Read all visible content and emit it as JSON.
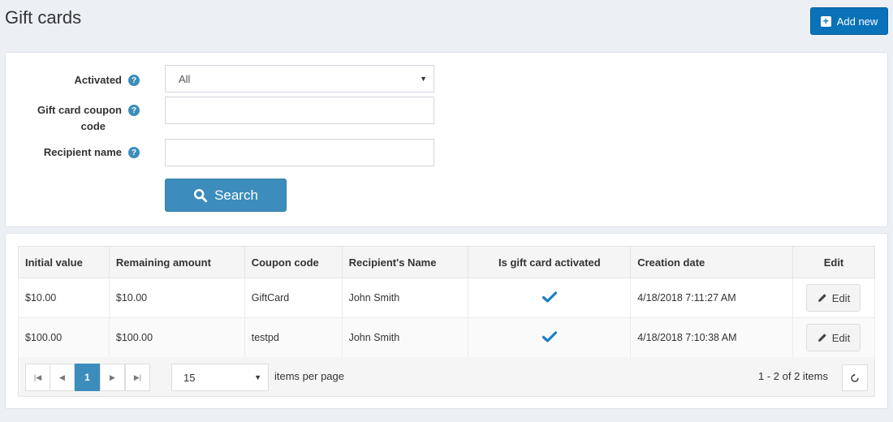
{
  "header": {
    "title": "Gift cards",
    "add_label": "Add new"
  },
  "search": {
    "activated_label": "Activated",
    "activated_value": "All",
    "coupon_label_line1": "Gift card coupon",
    "coupon_label_line2": "code",
    "coupon_value": "",
    "recipient_label": "Recipient name",
    "recipient_value": "",
    "search_label": "Search",
    "help_glyph": "?"
  },
  "grid": {
    "columns": [
      "Initial value",
      "Remaining amount",
      "Coupon code",
      "Recipient's Name",
      "Is gift card activated",
      "Creation date",
      "Edit"
    ],
    "rows": [
      {
        "initial": "$10.00",
        "remaining": "$10.00",
        "code": "GiftCard",
        "recipient": "John Smith",
        "activated": true,
        "created": "4/18/2018 7:11:27 AM",
        "edit": "Edit"
      },
      {
        "initial": "$100.00",
        "remaining": "$100.00",
        "code": "testpd",
        "recipient": "John Smith",
        "activated": true,
        "created": "4/18/2018 7:10:38 AM",
        "edit": "Edit"
      }
    ]
  },
  "pager": {
    "current_page": "1",
    "page_size": "15",
    "items_per_page_label": "items per page",
    "range_label": "1 - 2 of 2 items"
  },
  "colors": {
    "primary": "#3c8dbc",
    "add_button": "#0a72b9",
    "background": "#ecf0f5"
  },
  "icons": {
    "add": "plus-square-icon",
    "help": "question-circle-icon",
    "search": "search-icon",
    "activated": "checkmark-icon",
    "edit": "pencil-icon",
    "refresh": "refresh-icon"
  }
}
